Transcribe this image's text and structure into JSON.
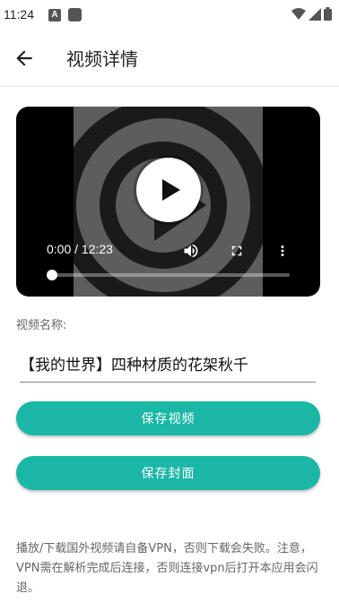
{
  "status_bar": {
    "time": "11:24",
    "notification_icon_letter": "A",
    "icons": [
      "wifi-icon",
      "signal-icon",
      "battery-icon"
    ]
  },
  "header": {
    "back_icon": "arrow-left-icon",
    "title": "视频详情"
  },
  "player": {
    "time_display": "0:00 / 12:23",
    "current_time": "0:00",
    "duration": "12:23",
    "progress": 0,
    "icons": [
      "play-icon",
      "volume-icon",
      "fullscreen-icon",
      "more-vertical-icon"
    ]
  },
  "form": {
    "name_label": "视频名称:",
    "name_value": "【我的世界】四种材质的花架秋千"
  },
  "actions": {
    "save_video_label": "保存视频",
    "save_cover_label": "保存封面"
  },
  "notice": {
    "text": "播放/下载国外视频请自备VPN，否则下载会失败。注意，VPN需在解析完成后连接，否则连接vpn后打开本应用会闪退。"
  },
  "colors": {
    "accent": "#1ab7a6",
    "player_background": "#000000",
    "thumbnail_gray": "#5d5d5d"
  }
}
